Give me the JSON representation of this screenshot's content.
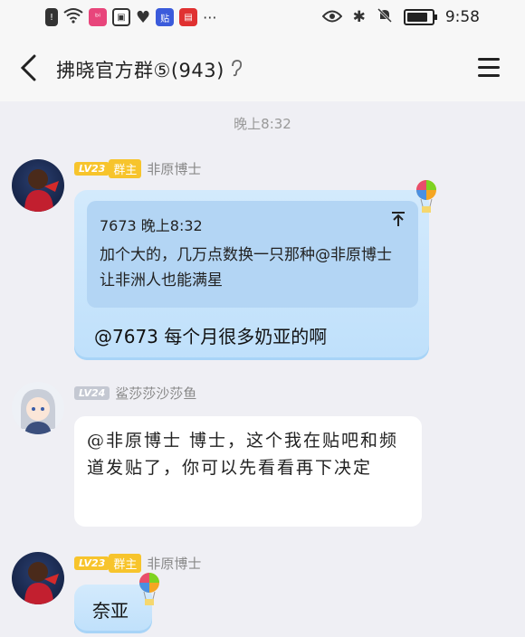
{
  "status_bar": {
    "time": "9:58",
    "left_icons": [
      "alert-icon",
      "wifi-icon",
      "app-icon-1",
      "app-icon-2",
      "heart-icon",
      "tieba-icon",
      "app-icon-3",
      "more-icon"
    ],
    "right_icons": [
      "eye-icon",
      "bluetooth-icon",
      "mute-icon",
      "battery-icon"
    ]
  },
  "header": {
    "title": "拂晓官方群⑤(943)"
  },
  "timestamp": "晚上8:32",
  "messages": [
    {
      "level": "LV23",
      "role": "群主",
      "sender": "非原博士",
      "quote_header": "7673 晚上8:32",
      "quote_text": "加个大的，几万点数换一只那种@非原博士 让非洲人也能满星",
      "text": "@7673 每个月很多奶亚的啊"
    },
    {
      "level": "LV24",
      "sender": "鲨莎莎沙莎鱼",
      "text": "@非原博士 博士，这个我在贴吧和频道发贴了，你可以先看看再下决定"
    },
    {
      "level": "LV23",
      "role": "群主",
      "sender": "非原博士",
      "text": "奈亚"
    }
  ],
  "colors": {
    "bubble_blue": "#c9e4fb",
    "quote_blue": "#b3d5f4",
    "badge_gold": "#f7c42c",
    "badge_grey": "#c4c8d2",
    "background": "#efeff4"
  }
}
